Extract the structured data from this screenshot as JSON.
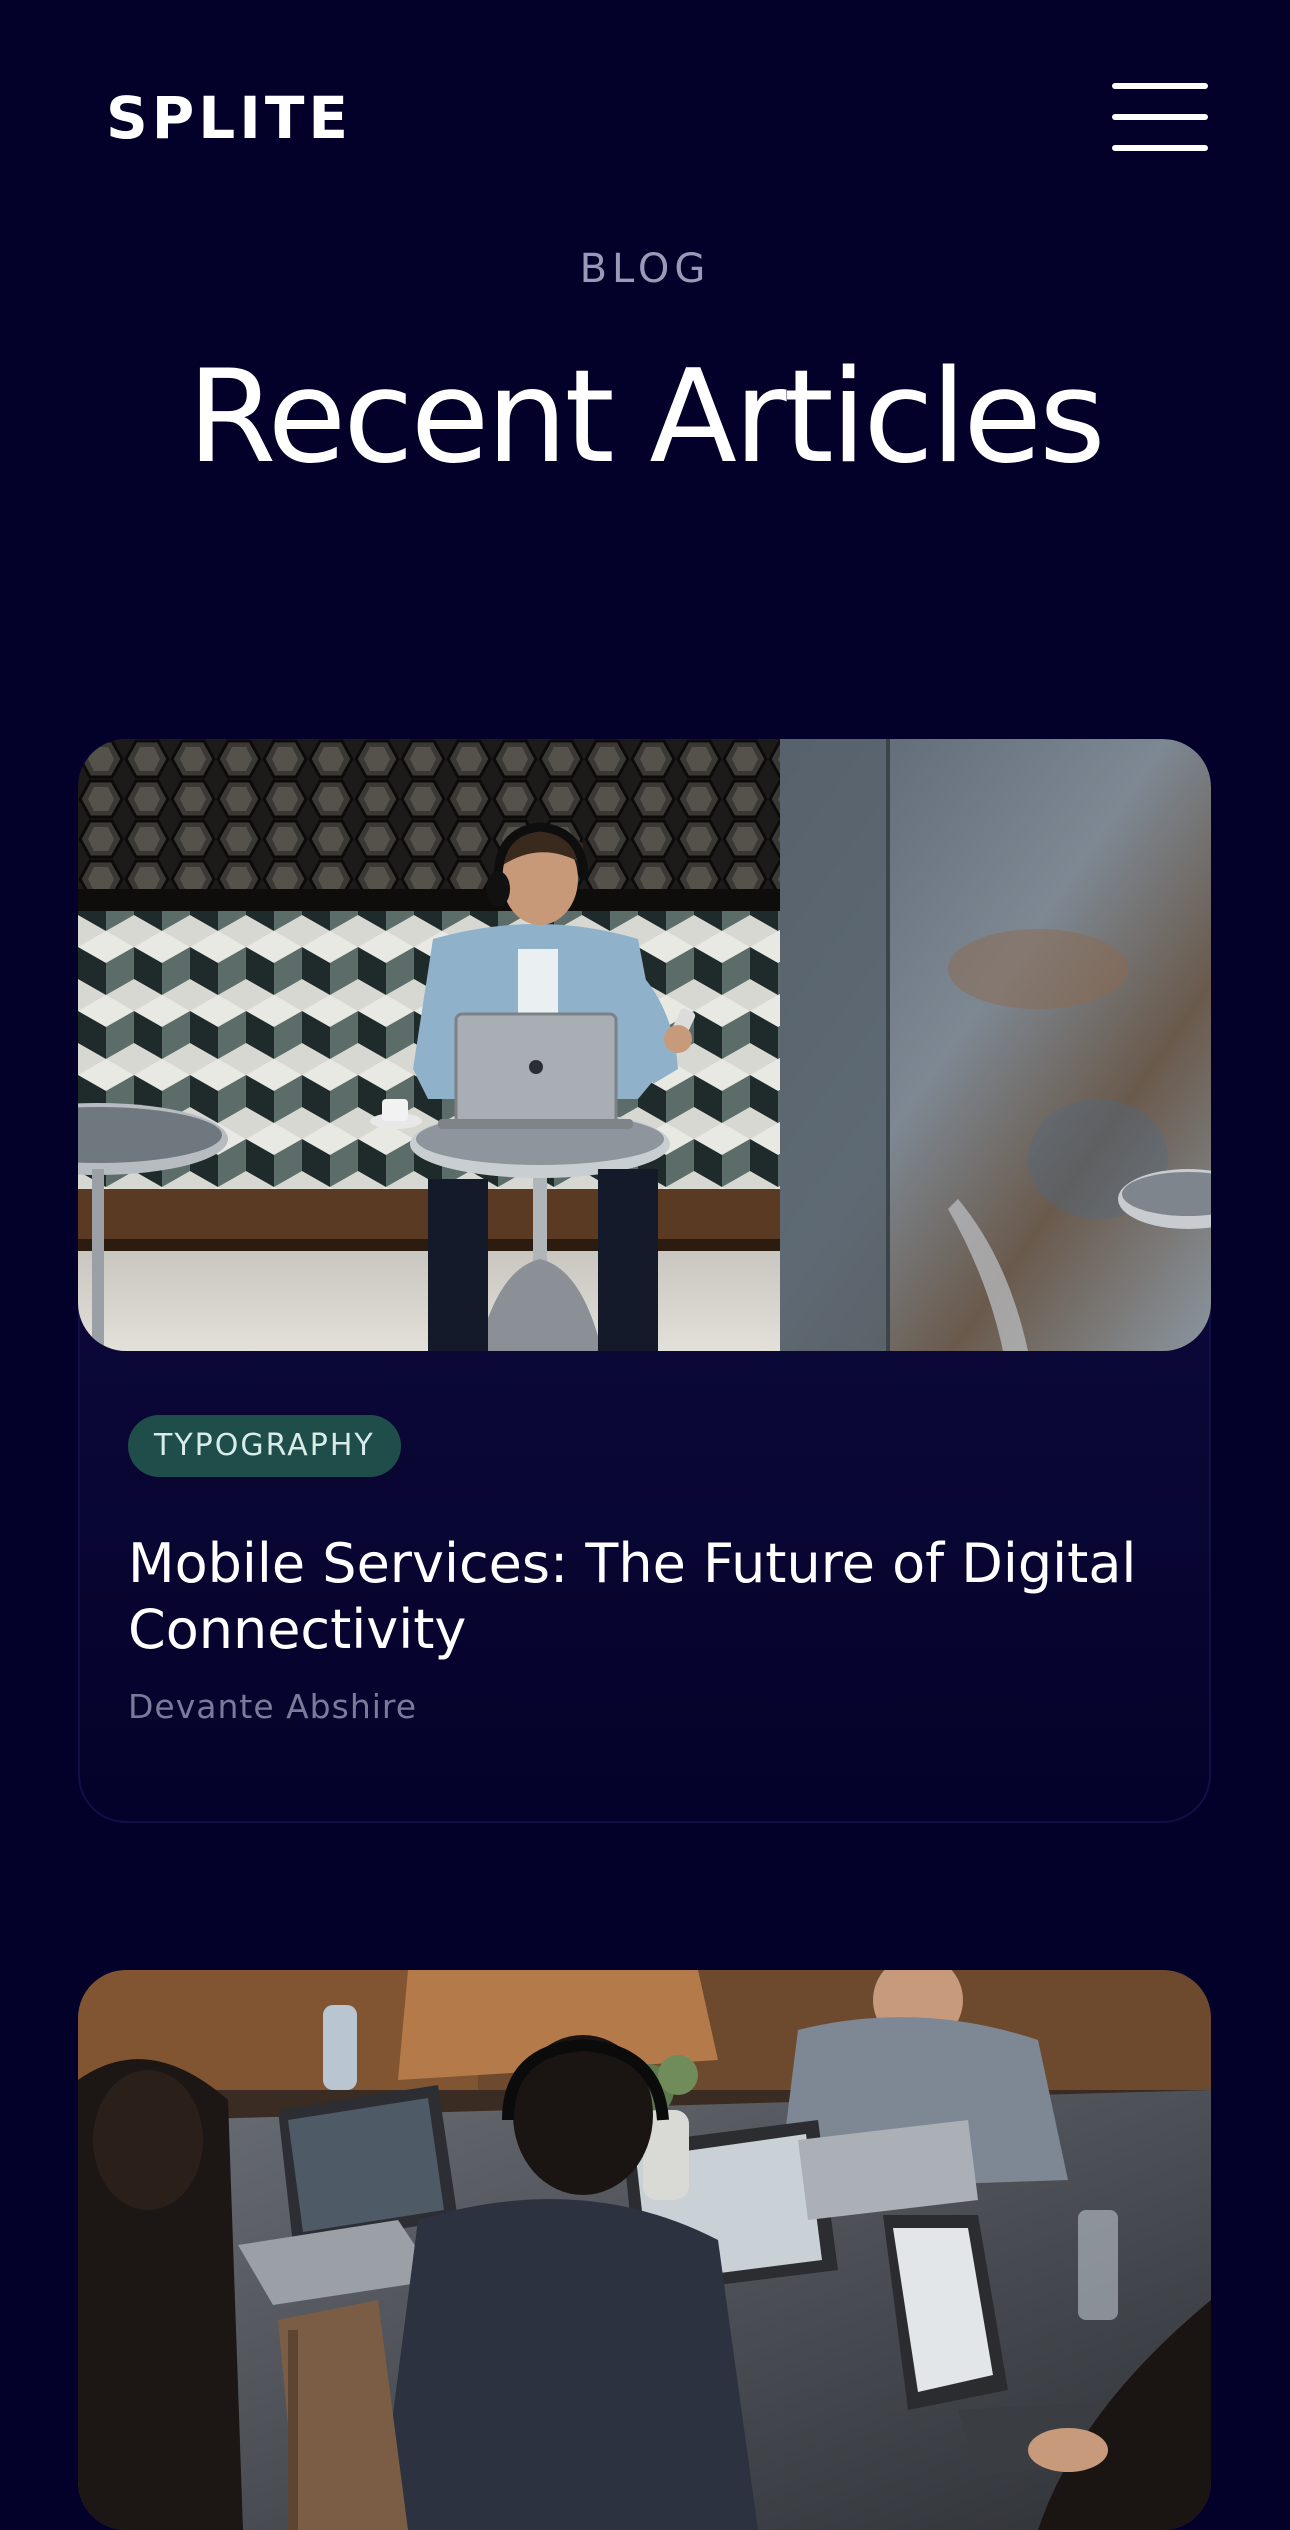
{
  "header": {
    "logo": "SPLITE",
    "menu_icon": "hamburger-menu-icon"
  },
  "hero": {
    "eyebrow": "BLOG",
    "title": "Recent Articles"
  },
  "articles": [
    {
      "category": "TYPOGRAPHY",
      "title": "Mobile Services: The Future of Digital Connectivity",
      "author": "Devante Abshire",
      "image_subject": "man-with-laptop-cafe-photo"
    },
    {
      "image_subject": "team-working-on-laptops-photo"
    }
  ],
  "colors": {
    "background": "#03012a",
    "badge": "#1e4d4a",
    "muted_text": "#7b7a9a"
  }
}
